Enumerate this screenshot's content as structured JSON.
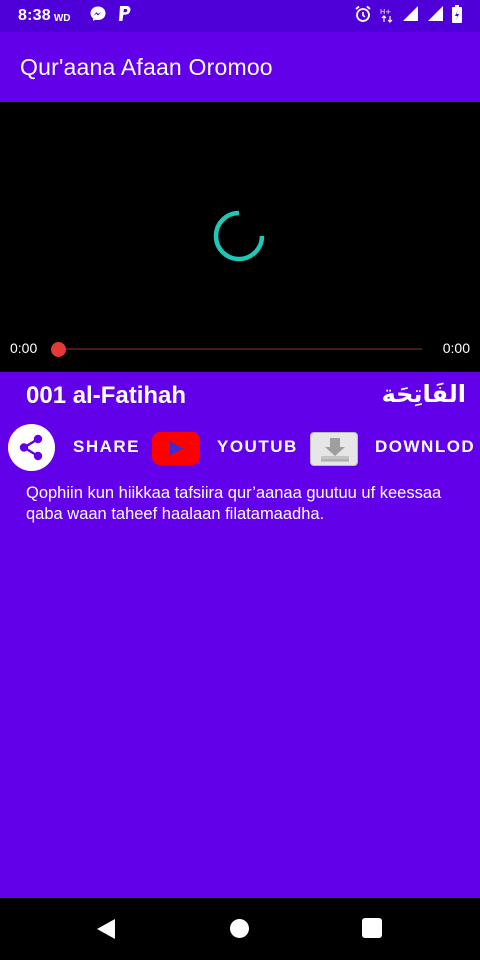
{
  "status": {
    "time": "8:38",
    "carrier_tag": "WD",
    "notification_icons": [
      "messenger-icon",
      "paypal-icon"
    ],
    "system_icons": [
      "alarm-icon",
      "signal-icon",
      "battery-icon"
    ]
  },
  "appbar": {
    "title": "Qur'aana Afaan Oromoo"
  },
  "player": {
    "current_time": "0:00",
    "duration": "0:00",
    "progress": 0.0,
    "state": "loading"
  },
  "surah": {
    "name": "001 al-Fatihah",
    "arabic": "الفَاتِحَة"
  },
  "actions": {
    "share_label": "SHARE",
    "youtube_label": "YOUTUB",
    "download_label": "DOWNLOD"
  },
  "description": "Qophiin kun hiikkaa tafsiira qur’aanaa guutuu uf keessaa qaba waan taheef haalaan filatamaadha.",
  "colors": {
    "primary": "#6200ea",
    "status_bar": "#4f00d9",
    "spinner": "#1ec8b4",
    "seek_thumb": "#e53935",
    "youtube_red": "#ff0000"
  },
  "nav": [
    "back-icon",
    "home-icon",
    "recents-icon"
  ]
}
